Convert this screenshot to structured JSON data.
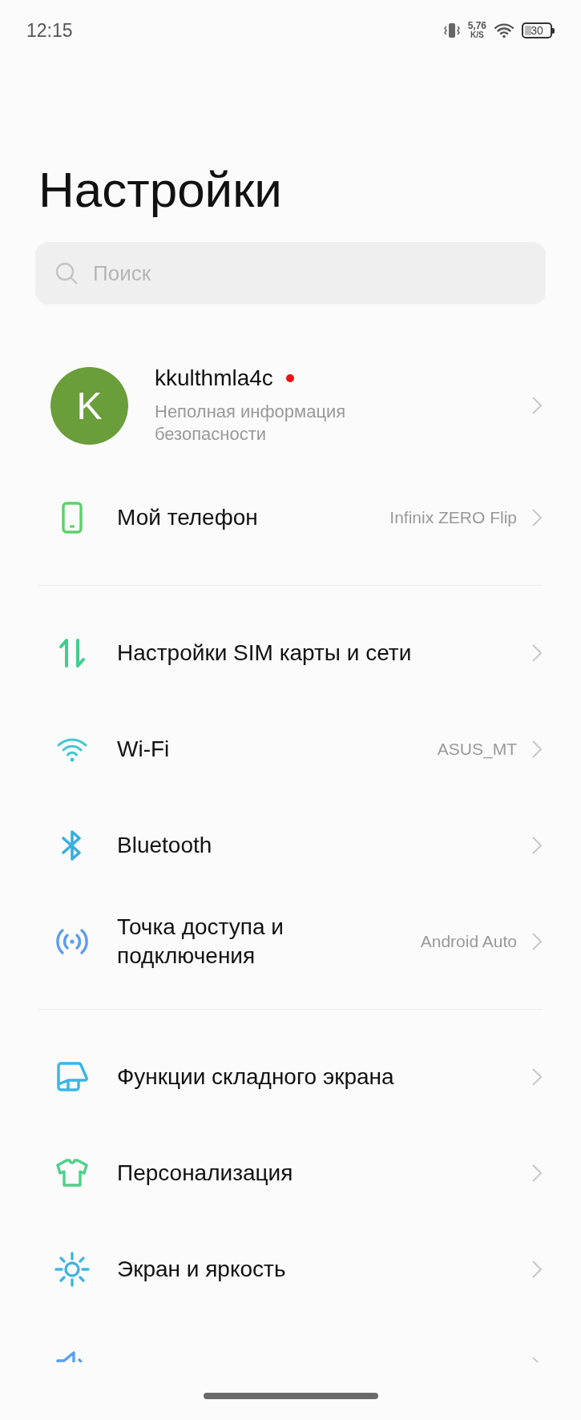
{
  "status_bar": {
    "time": "12:15",
    "speed": "5,76",
    "speed_unit": "K/S",
    "battery": "30"
  },
  "title": "Настройки",
  "search": {
    "placeholder": "Поиск"
  },
  "account": {
    "initial": "K",
    "name": "kkulthmla4c",
    "notification": true,
    "subtitle": "Неполная информация безопасности"
  },
  "sections": [
    {
      "items": [
        {
          "kind": "phone",
          "label": "Мой телефон",
          "value": "Infinix ZERO Flip"
        }
      ]
    },
    {
      "items": [
        {
          "kind": "sim",
          "label": "Настройки SIM карты и сети"
        },
        {
          "kind": "wifi",
          "label": "Wi-Fi",
          "value": "ASUS_MT"
        },
        {
          "kind": "bluetooth",
          "label": "Bluetooth"
        },
        {
          "kind": "hotspot",
          "label": "Точка доступа и подключения",
          "value": "Android Auto"
        }
      ]
    },
    {
      "items": [
        {
          "kind": "fold",
          "label": "Функции складного экрана"
        },
        {
          "kind": "theme",
          "label": "Персонализация"
        },
        {
          "kind": "display",
          "label": "Экран и яркость"
        }
      ]
    }
  ]
}
